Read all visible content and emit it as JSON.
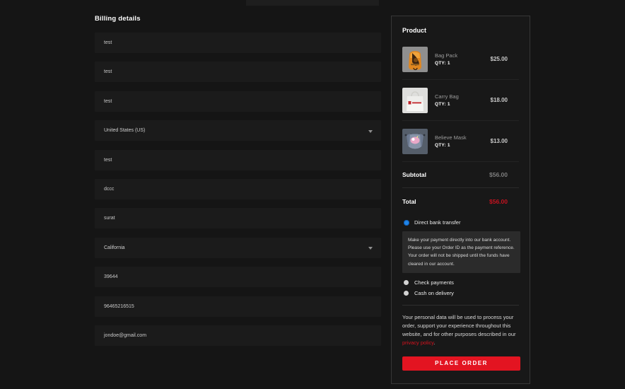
{
  "colors": {
    "accent_red": "#e31421",
    "radio_blue": "#2186e8",
    "page_bg": "#151515"
  },
  "billing": {
    "title": "Billing details",
    "fields": [
      {
        "value": "test"
      },
      {
        "value": "test"
      },
      {
        "value": "test"
      },
      {
        "value": "United States (US)"
      },
      {
        "value": "test"
      },
      {
        "value": "dccc"
      },
      {
        "value": "surat"
      },
      {
        "value": "California"
      },
      {
        "value": "39644"
      },
      {
        "value": "96465216515"
      },
      {
        "value": "jondoe@gmail.com"
      }
    ]
  },
  "order": {
    "title": "Product",
    "items": [
      {
        "name": "Bag Pack",
        "qty": "QTY: 1",
        "price": "$25.00",
        "image": "bag-pack-image"
      },
      {
        "name": "Carry Bag",
        "qty": "QTY: 1",
        "price": "$18.00",
        "image": "carry-bag-image"
      },
      {
        "name": "Believe Mask",
        "qty": "QTY: 1",
        "price": "$13.00",
        "image": "believe-mask-image"
      }
    ],
    "subtotal_label": "Subtotal",
    "subtotal_value": "$56.00",
    "total_label": "Total",
    "total_value": "$56.00"
  },
  "payment": {
    "methods": [
      {
        "label": "Direct bank transfer",
        "selected": true,
        "description": "Make your payment directly into our bank account. Please use your Order ID as the payment reference. Your order will not be shipped until the funds have cleared in our account."
      },
      {
        "label": "Check payments",
        "selected": false
      },
      {
        "label": "Cash on delivery",
        "selected": false
      }
    ],
    "privacy_before": "Your personal data will be used to process your order, support your experience throughout this website, and for other purposes described in our ",
    "privacy_link": "privacy policy",
    "privacy_after": ".",
    "place_order_label": "PLACE ORDER"
  }
}
